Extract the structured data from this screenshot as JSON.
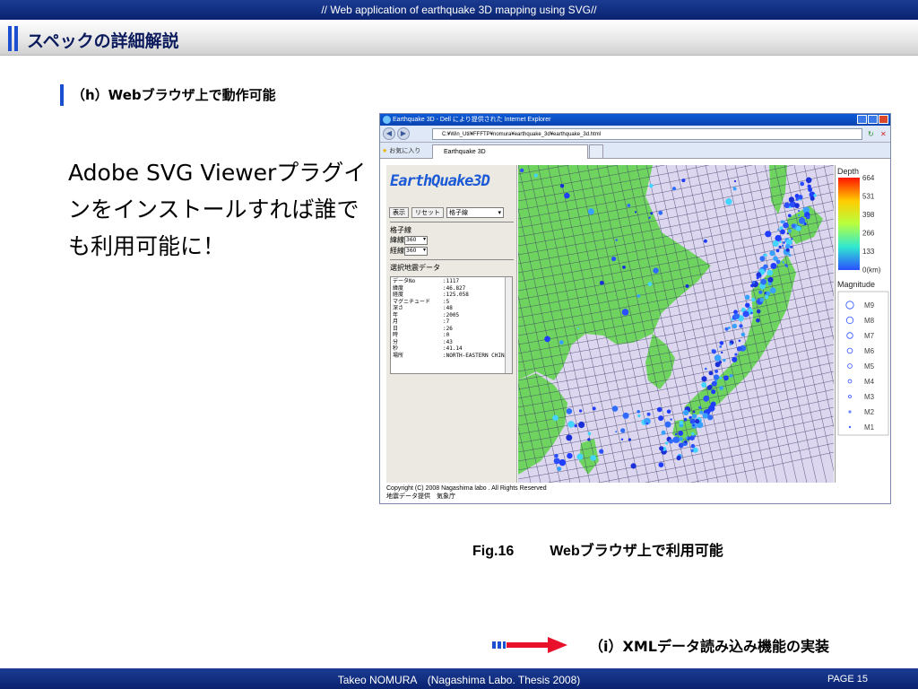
{
  "header": {
    "title": "// Web application of earthquake 3D mapping using SVG//"
  },
  "section": {
    "title": "スペックの詳細解説"
  },
  "subsection": {
    "title": "（h）Webブラウザ上で動作可能"
  },
  "body": {
    "text": "Adobe SVG Viewerプラグインをインストールすれば誰でも利用可能に！"
  },
  "browser": {
    "window_title": "Earthquake 3D - Dell により提供された Internet Explorer",
    "address": "C:¥Win_Util¥FFFTP¥nomura¥earthquake_3d¥earthquake_3d.html",
    "favorites_label": "お気に入り",
    "tab_label": "Earthquake 3D",
    "app": {
      "logo": "EarthQuake3D",
      "display_button": "表示",
      "reset_button": "リセット",
      "grid_select": "格子線",
      "grid_label": "格子線",
      "lat_label": "緯線",
      "lat_value": "360",
      "lon_label": "経線",
      "lon_value": "360",
      "selected_label": "選択地震データ",
      "data_rows": [
        {
          "k": "データNo",
          "v": ":1117"
        },
        {
          "k": "緯度",
          "v": ":46.827"
        },
        {
          "k": "経度",
          "v": ":125.058"
        },
        {
          "k": "マグニチュード",
          "v": ":5"
        },
        {
          "k": "深さ",
          "v": ":48"
        },
        {
          "k": "年",
          "v": ":2005"
        },
        {
          "k": "月",
          "v": ":7"
        },
        {
          "k": "日",
          "v": ":26"
        },
        {
          "k": "時",
          "v": ":0"
        },
        {
          "k": "分",
          "v": ":43"
        },
        {
          "k": "秒",
          "v": ":41.14"
        },
        {
          "k": "場所",
          "v": ":NORTH-EASTERN CHINA"
        }
      ],
      "depth_title": "Depth",
      "depth_ticks": [
        "664",
        "531",
        "398",
        "266",
        "133",
        "0(km)"
      ],
      "magnitude_title": "Magnitude",
      "magnitudes": [
        "M9",
        "M8",
        "M7",
        "M6",
        "M5",
        "M4",
        "M3",
        "M2",
        "M1"
      ],
      "copyright": "Copyright (C) 2008 Nagashima labo . All Rights Reserved",
      "data_source": "地震データ提供　気象庁"
    }
  },
  "caption": {
    "number": "Fig.16",
    "text": "Webブラウザ上で利用可能"
  },
  "next": {
    "label": "（i）XMLデータ読み込み機能の実装"
  },
  "footer": {
    "text": "Takeo NOMURA　(Nagashima Labo. Thesis 2008)",
    "page": "PAGE 15"
  },
  "colors": {
    "bar": "#0a2270",
    "accent": "#1c4fd0",
    "land": "#6fd35f",
    "sea": "#dcd6ee",
    "arrow": "#e8102a"
  }
}
